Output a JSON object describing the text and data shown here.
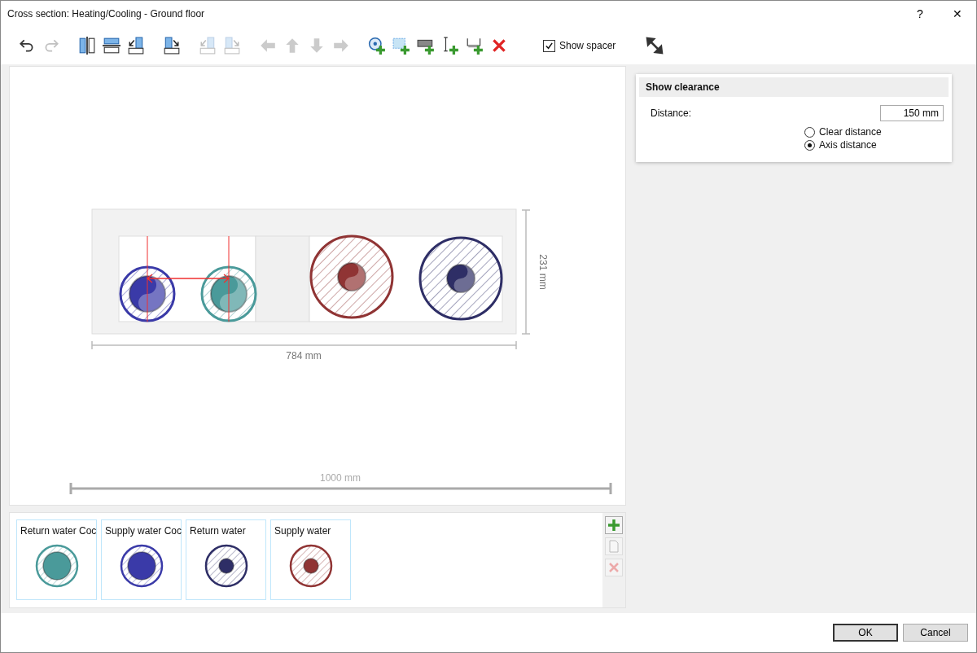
{
  "window": {
    "title": "Cross section: Heating/Cooling - Ground floor",
    "help": "?",
    "close": "✕"
  },
  "toolbar": {
    "buttons": [
      {
        "kind": "undo",
        "disabled": false
      },
      {
        "kind": "redo",
        "disabled": true
      },
      {
        "kind": "split-vertical",
        "disabled": false
      },
      {
        "kind": "split-horizontal",
        "disabled": false
      },
      {
        "kind": "insert-left",
        "disabled": false
      },
      {
        "kind": "insert-right",
        "disabled": false
      },
      {
        "kind": "insert-left",
        "disabled": true
      },
      {
        "kind": "insert-right",
        "disabled": true
      },
      {
        "kind": "arrow-left",
        "disabled": true
      },
      {
        "kind": "arrow-up",
        "disabled": true
      },
      {
        "kind": "arrow-down",
        "disabled": true
      },
      {
        "kind": "arrow-right",
        "disabled": true
      },
      {
        "kind": "add-pipe",
        "disabled": false
      },
      {
        "kind": "add-area",
        "disabled": false
      },
      {
        "kind": "add-block",
        "disabled": false
      },
      {
        "kind": "add-dimension",
        "disabled": false
      },
      {
        "kind": "add-bracket",
        "disabled": false
      },
      {
        "kind": "delete",
        "disabled": false
      }
    ],
    "show_spacer": {
      "label": "Show spacer",
      "checked": true
    }
  },
  "canvas": {
    "pipes": [
      {
        "kind": "small",
        "color": "#3a3aa8"
      },
      {
        "kind": "small",
        "color": "#4a9a9a"
      },
      {
        "kind": "large",
        "color": "#903434"
      },
      {
        "kind": "large",
        "color": "#2e2e66"
      }
    ],
    "width_label": "784 mm",
    "height_label": "231 mm",
    "total_label": "1000 mm"
  },
  "clearance": {
    "title": "Show clearance",
    "distance_label": "Distance:",
    "distance": "150 mm",
    "options": [
      {
        "label": "Clear distance",
        "selected": false
      },
      {
        "label": "Axis distance",
        "selected": true
      }
    ]
  },
  "palette": {
    "items": [
      {
        "label": "Return water Coc",
        "kind": "small",
        "color": "#4a9a9a"
      },
      {
        "label": "Supply water Coc",
        "kind": "small",
        "color": "#3a3aa8"
      },
      {
        "label": "Return water",
        "kind": "large",
        "color": "#2e2e66"
      },
      {
        "label": "Supply water",
        "kind": "large",
        "color": "#903434"
      }
    ],
    "actions": [
      {
        "kind": "add",
        "disabled": false
      },
      {
        "kind": "copy",
        "disabled": true
      },
      {
        "kind": "delete",
        "disabled": true
      }
    ]
  },
  "buttons": [
    {
      "label": "OK",
      "default": true
    },
    {
      "label": "Cancel",
      "default": false
    }
  ]
}
